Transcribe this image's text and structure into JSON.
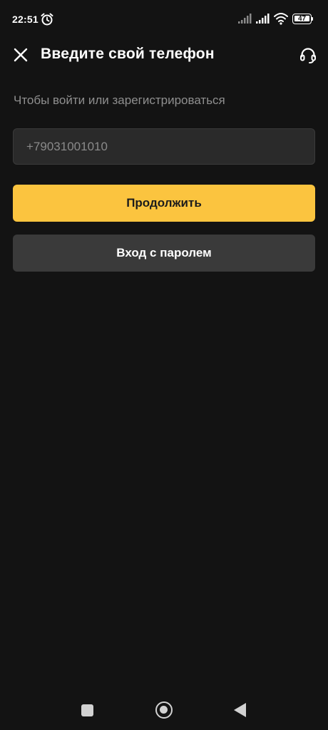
{
  "status_bar": {
    "time": "22:51",
    "battery_level": "47",
    "icons": [
      "alarm-icon",
      "signal-icon",
      "signal-icon",
      "wifi-icon",
      "battery-icon"
    ]
  },
  "header": {
    "title": "Введите свой телефон",
    "close_icon": "close-icon",
    "support_icon": "headset-icon"
  },
  "subtitle": "Чтобы войти или зарегистрироваться",
  "phone_input": {
    "value": "",
    "placeholder": "+79031001010"
  },
  "buttons": {
    "continue_label": "Продолжить",
    "password_login_label": "Вход с паролем"
  },
  "colors": {
    "background": "#131313",
    "accent": "#fbc43f",
    "secondary_button": "#3a3a3a",
    "input_background": "#2a2a2a"
  },
  "nav_bar": {
    "icons": [
      "recents-icon",
      "home-icon",
      "back-icon"
    ]
  }
}
